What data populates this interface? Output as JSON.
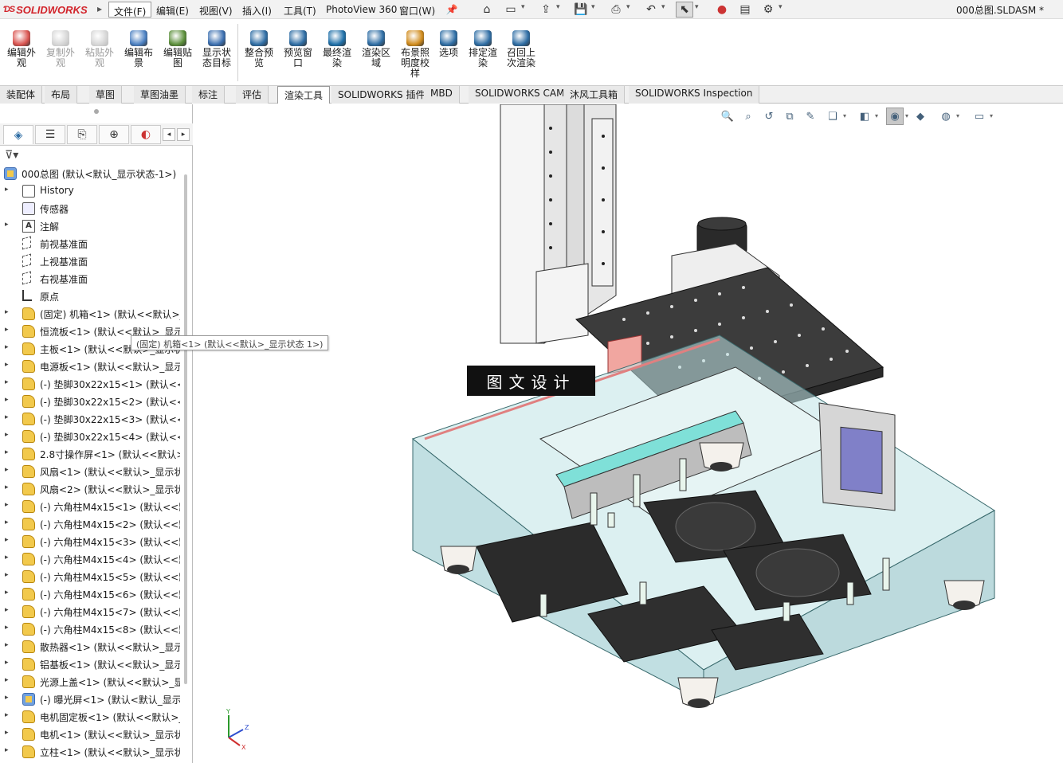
{
  "app": {
    "brand": "SOLIDWORKS",
    "document_title": "000总图.SLDASM *"
  },
  "menu": [
    {
      "label": "文件(F)",
      "active": true
    },
    {
      "label": "编辑(E)"
    },
    {
      "label": "视图(V)"
    },
    {
      "label": "插入(I)"
    },
    {
      "label": "工具(T)"
    },
    {
      "label": "PhotoView 360"
    },
    {
      "label": "窗口(W)"
    }
  ],
  "quick_access": [
    "home-icon",
    "new-document-icon",
    "open-icon",
    "save-icon",
    "print-icon",
    "undo-icon",
    "select-icon",
    "rebuild-icon",
    "file-properties-icon",
    "options-icon"
  ],
  "ribbon": [
    {
      "label": "编辑外观",
      "lines": [
        "编辑外",
        "观"
      ],
      "color": "#d9534f",
      "disabled": false
    },
    {
      "label": "复制外观",
      "lines": [
        "复制外",
        "观"
      ],
      "color": "#888888",
      "disabled": true
    },
    {
      "label": "粘贴外观",
      "lines": [
        "粘贴外",
        "观"
      ],
      "color": "#888888",
      "disabled": true
    },
    {
      "label": "编辑布景",
      "lines": [
        "编辑布",
        "景"
      ],
      "color": "#4a7fc1",
      "disabled": false
    },
    {
      "label": "编辑贴图",
      "lines": [
        "编辑贴",
        "图"
      ],
      "color": "#5b8f3a",
      "disabled": false
    },
    {
      "label": "显示状态目标",
      "lines": [
        "显示状",
        "态目标"
      ],
      "color": "#3b6fb0",
      "disabled": false
    },
    {
      "label": "整合预览",
      "lines": [
        "整合预",
        "览"
      ],
      "color": "#2e6da4",
      "disabled": false
    },
    {
      "label": "预览窗口",
      "lines": [
        "预览窗",
        "口"
      ],
      "color": "#2e6da4",
      "disabled": false
    },
    {
      "label": "最终渲染",
      "lines": [
        "最终渲",
        "染"
      ],
      "color": "#1e6fa8",
      "disabled": false
    },
    {
      "label": "渲染区域",
      "lines": [
        "渲染区",
        "域"
      ],
      "color": "#2e6da4",
      "disabled": false
    },
    {
      "label": "布景照明度校样",
      "lines": [
        "布景照",
        "明度校",
        "样"
      ],
      "color": "#d08b1c",
      "disabled": false
    },
    {
      "label": "选项",
      "lines": [
        "选项"
      ],
      "color": "#2e6da4",
      "disabled": false
    },
    {
      "label": "排定渲染",
      "lines": [
        "排定渲",
        "染"
      ],
      "color": "#2e6da4",
      "disabled": false
    },
    {
      "label": "召回上次渲染",
      "lines": [
        "召回上",
        "次渲染"
      ],
      "color": "#2e6da4",
      "disabled": false
    }
  ],
  "command_tabs": [
    {
      "label": "装配体"
    },
    {
      "label": "布局"
    },
    {
      "label": "草图"
    },
    {
      "label": "草图油墨"
    },
    {
      "label": "标注"
    },
    {
      "label": "评估"
    },
    {
      "label": "渲染工具",
      "active": true
    },
    {
      "label": "SOLIDWORKS 插件"
    },
    {
      "label": "MBD"
    },
    {
      "label": "SOLIDWORKS CAM"
    },
    {
      "label": "沐风工具箱"
    },
    {
      "label": "SOLIDWORKS Inspection"
    }
  ],
  "panel_tabs": [
    "feature-manager-icon",
    "property-manager-icon",
    "configuration-manager-icon",
    "dimxpert-icon",
    "display-manager-icon"
  ],
  "tree": {
    "root": "000总图  (默认<默认_显示状态-1>)",
    "items": [
      {
        "label": "History",
        "icon": "hist",
        "expandable": true
      },
      {
        "label": "传感器",
        "icon": "sensor",
        "expandable": false
      },
      {
        "label": "注解",
        "icon": "ann",
        "expandable": true
      },
      {
        "label": "前视基准面",
        "icon": "plane",
        "expandable": false
      },
      {
        "label": "上视基准面",
        "icon": "plane",
        "expandable": false
      },
      {
        "label": "右视基准面",
        "icon": "plane",
        "expandable": false
      },
      {
        "label": "原点",
        "icon": "origin",
        "expandable": false
      },
      {
        "label": "(固定) 机箱<1> (默认<<默认>_",
        "icon": "part",
        "expandable": true
      },
      {
        "label": "恒流板<1> (默认<<默认>_显示",
        "icon": "part",
        "expandable": true
      },
      {
        "label": "主板<1> (默认<<默认>_显示状",
        "icon": "part",
        "expandable": true
      },
      {
        "label": "电源板<1> (默认<<默认>_显示",
        "icon": "part",
        "expandable": true
      },
      {
        "label": "(-) 垫脚30x22x15<1> (默认<<默",
        "icon": "part",
        "expandable": true
      },
      {
        "label": "(-) 垫脚30x22x15<2> (默认<<默",
        "icon": "part",
        "expandable": true
      },
      {
        "label": "(-) 垫脚30x22x15<3> (默认<<默",
        "icon": "part",
        "expandable": true
      },
      {
        "label": "(-) 垫脚30x22x15<4> (默认<<默",
        "icon": "part",
        "expandable": true
      },
      {
        "label": "2.8寸操作屏<1> (默认<<默认>_",
        "icon": "part",
        "expandable": true
      },
      {
        "label": "风扇<1> (默认<<默认>_显示状",
        "icon": "part",
        "expandable": true
      },
      {
        "label": "风扇<2> (默认<<默认>_显示状",
        "icon": "part",
        "expandable": true
      },
      {
        "label": "(-) 六角柱M4x15<1> (默认<<默",
        "icon": "part",
        "expandable": true
      },
      {
        "label": "(-) 六角柱M4x15<2> (默认<<默",
        "icon": "part",
        "expandable": true
      },
      {
        "label": "(-) 六角柱M4x15<3> (默认<<默",
        "icon": "part",
        "expandable": true
      },
      {
        "label": "(-) 六角柱M4x15<4> (默认<<默",
        "icon": "part",
        "expandable": true
      },
      {
        "label": "(-) 六角柱M4x15<5> (默认<<默",
        "icon": "part",
        "expandable": true
      },
      {
        "label": "(-) 六角柱M4x15<6> (默认<<默",
        "icon": "part",
        "expandable": true
      },
      {
        "label": "(-) 六角柱M4x15<7> (默认<<默",
        "icon": "part",
        "expandable": true
      },
      {
        "label": "(-) 六角柱M4x15<8> (默认<<默",
        "icon": "part",
        "expandable": true
      },
      {
        "label": "散热器<1> (默认<<默认>_显示",
        "icon": "part",
        "expandable": true
      },
      {
        "label": "铝基板<1> (默认<<默认>_显示",
        "icon": "part",
        "expandable": true
      },
      {
        "label": "光源上盖<1> (默认<<默认>_显",
        "icon": "part",
        "expandable": true
      },
      {
        "label": "(-) 曝光屏<1> (默认<默认_显示",
        "icon": "asm",
        "expandable": true
      },
      {
        "label": "电机固定板<1> (默认<<默认>_",
        "icon": "part",
        "expandable": true
      },
      {
        "label": "电机<1> (默认<<默认>_显示状",
        "icon": "part",
        "expandable": true
      },
      {
        "label": "立柱<1> (默认<<默认>_显示状",
        "icon": "part",
        "expandable": true
      }
    ]
  },
  "tooltip": "(固定) 机箱<1> (默认<<默认>_显示状态 1>)",
  "view_toolbar": [
    "zoom-to-fit-icon",
    "zoom-to-area-icon",
    "previous-view-icon",
    "section-view-icon",
    "dynamic-annotation-icon",
    "view-orientation-icon",
    "display-style-icon",
    "hide-show-items-icon",
    "edit-appearance-icon",
    "apply-scene-icon",
    "view-settings-icon"
  ],
  "watermark": "图文设计",
  "triad": {
    "x": "X",
    "y": "Y",
    "z": "Z"
  },
  "colors": {
    "accent_blue": "#2e6da4",
    "glass": "#9fd3d6",
    "brand_red": "#d2232a"
  }
}
